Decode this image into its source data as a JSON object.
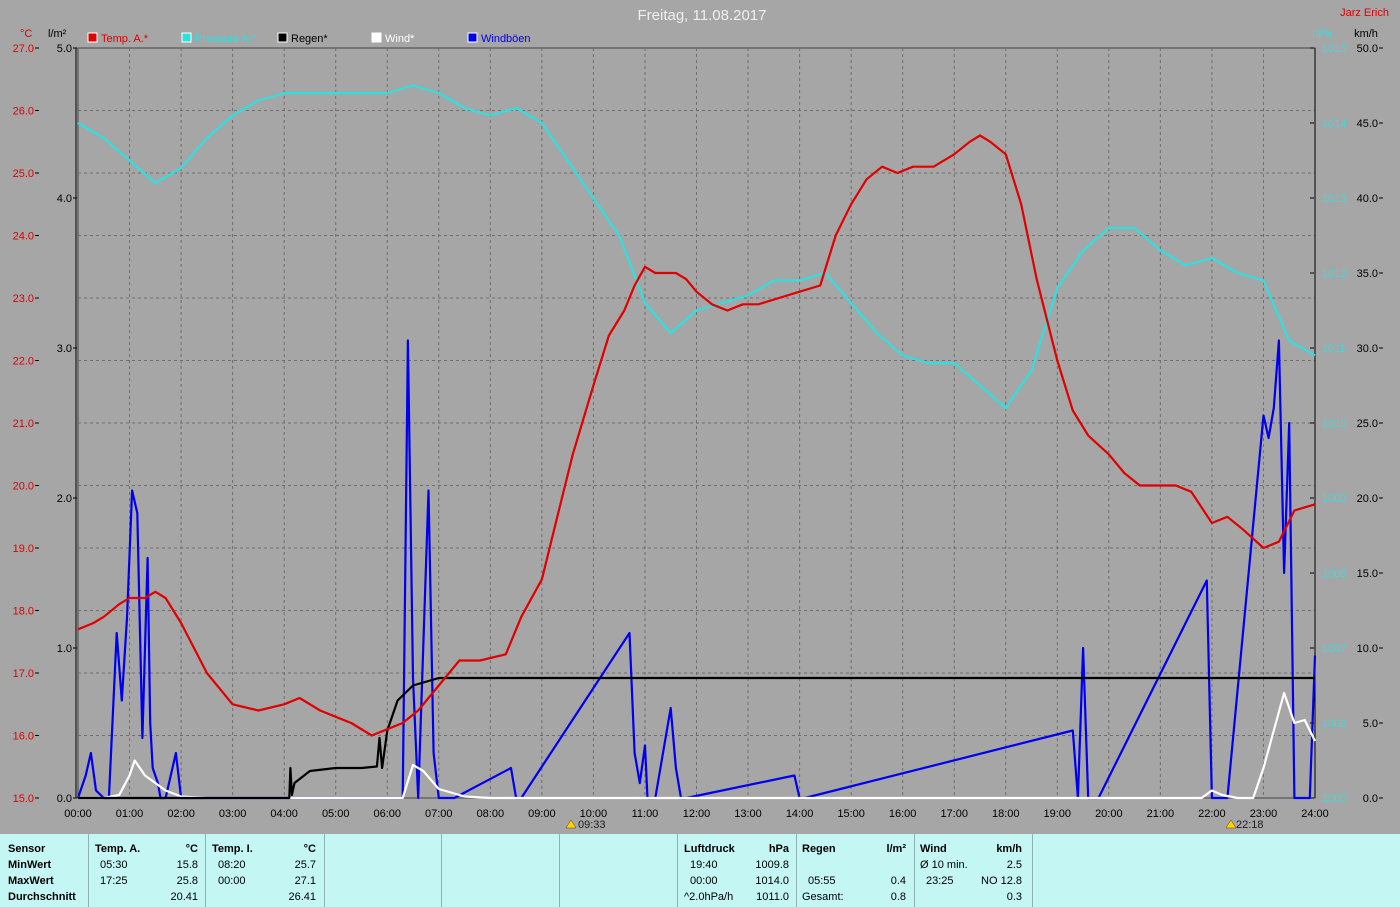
{
  "header": {
    "title": "Freitag, 11.08.2017",
    "author": "Jarz Erich"
  },
  "axis_units": {
    "temp": "°C",
    "rain": "l/m²",
    "pressure": "hPa",
    "wind": "km/h"
  },
  "legend": [
    {
      "label": "Temp. A.*",
      "color": "#e00000"
    },
    {
      "label": "Pressure A.*",
      "color": "#2ee0e0"
    },
    {
      "label": "Regen*",
      "color": "#000000"
    },
    {
      "label": "Wind*",
      "color": "#ffffff"
    },
    {
      "label": "Windböen",
      "color": "#0000ee"
    }
  ],
  "markers": {
    "sunrise": "09:33",
    "sunset": "22:18"
  },
  "chart_data": {
    "type": "line",
    "title": "Freitag, 11.08.2017",
    "grid": true,
    "legend_position": "top-left",
    "x_ticks": [
      "00:00",
      "01:00",
      "02:00",
      "03:00",
      "04:00",
      "05:00",
      "06:00",
      "07:00",
      "08:00",
      "09:00",
      "10:00",
      "11:00",
      "12:00",
      "13:00",
      "14:00",
      "15:00",
      "16:00",
      "17:00",
      "18:00",
      "19:00",
      "20:00",
      "21:00",
      "22:00",
      "23:00",
      "24:00"
    ],
    "axes": {
      "temp": {
        "ylim": [
          15.0,
          27.0
        ],
        "ticks": [
          "15.0",
          "16.0",
          "17.0",
          "18.0",
          "19.0",
          "20.0",
          "21.0",
          "22.0",
          "23.0",
          "24.0",
          "25.0",
          "26.0",
          "27.0"
        ],
        "color": "#e00000"
      },
      "rain": {
        "ylim": [
          0.0,
          5.0
        ],
        "ticks": [
          "0.0",
          "1.0",
          "2.0",
          "3.0",
          "4.0",
          "5.0"
        ],
        "color": "#000000"
      },
      "pressure": {
        "ylim": [
          1005,
          1015
        ],
        "ticks": [
          "1005",
          "1006",
          "1007",
          "1008",
          "1009",
          "1010",
          "1011",
          "1012",
          "1013",
          "1014",
          "1015"
        ],
        "color": "#2ee0e0"
      },
      "wind": {
        "ylim": [
          0.0,
          50.0
        ],
        "ticks": [
          "0.0",
          "5.0",
          "10.0",
          "15.0",
          "20.0",
          "25.0",
          "30.0",
          "35.0",
          "40.0",
          "45.0",
          "50.0"
        ],
        "color": "#000000"
      }
    },
    "series": [
      {
        "name": "Temp. A.*",
        "axis": "temp",
        "color": "#e00000",
        "x": [
          0,
          0.3,
          0.5,
          0.8,
          1.0,
          1.3,
          1.5,
          1.7,
          2.0,
          2.5,
          3.0,
          3.5,
          4.0,
          4.3,
          4.7,
          5.0,
          5.3,
          5.7,
          6.0,
          6.3,
          6.6,
          7.0,
          7.4,
          7.8,
          8.3,
          8.6,
          9.0,
          9.3,
          9.6,
          10.0,
          10.3,
          10.6,
          10.8,
          11.0,
          11.2,
          11.4,
          11.6,
          11.8,
          12.0,
          12.3,
          12.6,
          12.9,
          13.2,
          13.6,
          14.0,
          14.4,
          14.7,
          15.0,
          15.3,
          15.6,
          15.9,
          16.2,
          16.6,
          17.0,
          17.3,
          17.5,
          17.7,
          18.0,
          18.3,
          18.6,
          19.0,
          19.3,
          19.6,
          20.0,
          20.3,
          20.6,
          21.0,
          21.3,
          21.6,
          22.0,
          22.3,
          22.6,
          23.0,
          23.3,
          23.6,
          24.0
        ],
        "values": [
          17.7,
          17.8,
          17.9,
          18.1,
          18.2,
          18.2,
          18.3,
          18.2,
          17.8,
          17.0,
          16.5,
          16.4,
          16.5,
          16.6,
          16.4,
          16.3,
          16.2,
          16.0,
          16.1,
          16.2,
          16.4,
          16.8,
          17.2,
          17.2,
          17.3,
          17.9,
          18.5,
          19.5,
          20.5,
          21.6,
          22.4,
          22.8,
          23.2,
          23.5,
          23.4,
          23.4,
          23.4,
          23.3,
          23.1,
          22.9,
          22.8,
          22.9,
          22.9,
          23.0,
          23.1,
          23.2,
          24.0,
          24.5,
          24.9,
          25.1,
          25.0,
          25.1,
          25.1,
          25.3,
          25.5,
          25.6,
          25.5,
          25.3,
          24.5,
          23.3,
          22.0,
          21.2,
          20.8,
          20.5,
          20.2,
          20.0,
          20.0,
          20.0,
          19.9,
          19.4,
          19.5,
          19.3,
          19.0,
          19.1,
          19.6,
          19.7
        ]
      },
      {
        "name": "Pressure A.*",
        "axis": "pressure",
        "color": "#2ee0e0",
        "x": [
          0,
          0.5,
          1.0,
          1.5,
          2.0,
          2.5,
          3.0,
          3.5,
          4.0,
          4.5,
          5.0,
          5.5,
          6.0,
          6.5,
          7.0,
          7.5,
          8.0,
          8.5,
          9.0,
          9.5,
          10.0,
          10.5,
          11.0,
          11.5,
          12.0,
          12.5,
          13.0,
          13.5,
          14.0,
          14.5,
          15.0,
          15.5,
          16.0,
          16.5,
          17.0,
          17.5,
          18.0,
          18.5,
          19.0,
          19.5,
          20.0,
          20.5,
          21.0,
          21.5,
          22.0,
          22.5,
          23.0,
          23.5,
          24.0
        ],
        "values": [
          1014.0,
          1013.8,
          1013.5,
          1013.2,
          1013.4,
          1013.8,
          1014.1,
          1014.3,
          1014.4,
          1014.4,
          1014.4,
          1014.4,
          1014.4,
          1014.5,
          1014.4,
          1014.2,
          1014.1,
          1014.2,
          1014.0,
          1013.5,
          1013.0,
          1012.5,
          1011.6,
          1011.2,
          1011.5,
          1011.6,
          1011.7,
          1011.9,
          1011.9,
          1012.0,
          1011.6,
          1011.2,
          1010.9,
          1010.8,
          1010.8,
          1010.5,
          1010.2,
          1010.7,
          1011.8,
          1012.3,
          1012.6,
          1012.6,
          1012.3,
          1012.1,
          1012.2,
          1012.0,
          1011.9,
          1011.1,
          1010.9
        ]
      },
      {
        "name": "Regen*",
        "axis": "rain",
        "color": "#000000",
        "x": [
          0,
          4.1,
          4.12,
          4.15,
          4.2,
          4.5,
          5.0,
          5.5,
          5.8,
          5.85,
          5.9,
          6.0,
          6.2,
          6.5,
          6.8,
          7.0,
          7.5,
          8.0,
          12.0,
          18.0,
          24.0
        ],
        "values": [
          0,
          0,
          0.2,
          0.02,
          0.1,
          0.18,
          0.2,
          0.2,
          0.21,
          0.4,
          0.2,
          0.45,
          0.65,
          0.75,
          0.78,
          0.8,
          0.8,
          0.8,
          0.8,
          0.8,
          0.8
        ]
      },
      {
        "name": "Wind*",
        "axis": "wind",
        "color": "#ffffff",
        "x": [
          0,
          0.5,
          0.8,
          1.0,
          1.1,
          1.3,
          1.5,
          1.7,
          2.0,
          2.5,
          5.5,
          6.3,
          6.5,
          6.7,
          7.0,
          7.3,
          7.5,
          8.0,
          21.8,
          22.0,
          22.2,
          22.5,
          22.8,
          23.0,
          23.2,
          23.4,
          23.6,
          23.8,
          24.0
        ],
        "values": [
          0,
          0,
          0.2,
          1.5,
          2.5,
          1.5,
          1.0,
          0.5,
          0.1,
          0,
          0,
          0,
          2.2,
          1.8,
          0.6,
          0.3,
          0.1,
          0,
          0,
          0.5,
          0.2,
          0,
          0,
          2.0,
          4.5,
          7.0,
          5.0,
          5.2,
          3.8
        ]
      },
      {
        "name": "Windböen",
        "axis": "wind",
        "color": "#0000ee",
        "x": [
          0,
          0.15,
          0.25,
          0.35,
          0.5,
          0.6,
          0.75,
          0.85,
          0.95,
          1.05,
          1.15,
          1.25,
          1.35,
          1.4,
          1.45,
          1.5,
          1.55,
          1.6,
          1.65,
          1.7,
          1.9,
          2.0,
          2.1,
          4.0,
          6.3,
          6.4,
          6.5,
          6.6,
          6.8,
          6.9,
          7.0,
          7.1,
          7.2,
          7.3,
          8.4,
          8.5,
          8.6,
          10.7,
          10.8,
          10.9,
          11.0,
          11.05,
          11.1,
          11.2,
          11.5,
          11.6,
          11.7,
          11.8,
          13.9,
          14.0,
          14.1,
          19.3,
          19.4,
          19.5,
          19.6,
          19.7,
          19.8,
          21.9,
          22.0,
          22.1,
          22.2,
          22.3,
          23.0,
          23.1,
          23.2,
          23.3,
          23.4,
          23.5,
          23.6,
          23.7,
          23.8,
          23.9,
          24.0
        ],
        "values": [
          0,
          1.5,
          3.0,
          0.5,
          0,
          0,
          11.0,
          6.5,
          12.0,
          20.5,
          19.0,
          4.0,
          16.0,
          5.0,
          2.0,
          1.5,
          1.0,
          0,
          0,
          0,
          3.0,
          0,
          0,
          0,
          0,
          30.5,
          8.0,
          0,
          20.5,
          3.0,
          0,
          0,
          0,
          0,
          2.0,
          0,
          0,
          11.0,
          3.0,
          1.0,
          3.5,
          0,
          0,
          0,
          6.0,
          2.0,
          0,
          0,
          1.5,
          0,
          0,
          4.5,
          0,
          10.0,
          0,
          0,
          0,
          14.5,
          0,
          0,
          0,
          0,
          25.5,
          24.0,
          26.0,
          30.5,
          15.0,
          25.0,
          0,
          0,
          0,
          0,
          9.5
        ]
      }
    ]
  },
  "table": {
    "row_labels": [
      "Sensor",
      "MinWert",
      "MaxWert",
      "Durchschnitt"
    ],
    "temp_a": {
      "title": "Temp. A.",
      "unit": "°C",
      "min_time": "05:30",
      "min_val": "15.8",
      "max_time": "17:25",
      "max_val": "25.8",
      "avg": "20.41"
    },
    "temp_i": {
      "title": "Temp. I.",
      "unit": "°C",
      "min_time": "08:20",
      "min_val": "25.7",
      "max_time": "00:00",
      "max_val": "27.1",
      "avg": "26.41"
    },
    "pressure": {
      "title": "Luftdruck",
      "unit": "hPa",
      "min_time": "19:40",
      "min_val": "1009.8",
      "max_time": "00:00",
      "max_val": "1014.0",
      "avg_label": "^2.0hPa/h",
      "avg": "1011.0"
    },
    "rain": {
      "title": "Regen",
      "unit": "l/m²",
      "max_time": "05:55",
      "max_val": "0.4",
      "total_label": "Gesamt:",
      "total": "0.8"
    },
    "wind": {
      "title": "Wind",
      "unit": "km/h",
      "min_label": "Ø 10 min.",
      "min_val": "2.5",
      "max_time": "23:25",
      "max_val": "NO 12.8",
      "avg": "0.3"
    }
  }
}
